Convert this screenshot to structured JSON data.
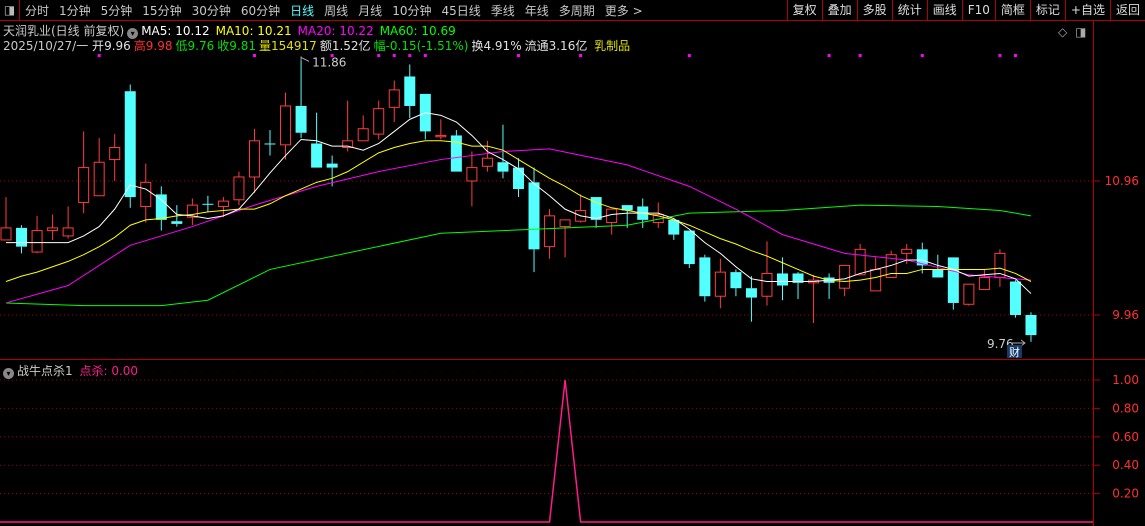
{
  "toolbar": {
    "toggle_icon": "panel-toggle-icon",
    "periods": [
      "分时",
      "1分钟",
      "5分钟",
      "15分钟",
      "30分钟",
      "60分钟",
      "日线",
      "周线",
      "月线",
      "10分钟",
      "45日线",
      "季线",
      "年线",
      "多周期",
      "更多 >"
    ],
    "active_period": "日线",
    "right_buttons": [
      "复权",
      "叠加",
      "多股",
      "统计",
      "画线",
      "F10",
      "简框",
      "标记",
      "+自选",
      "返回"
    ]
  },
  "header": {
    "title": "天润乳业(日线 前复权)",
    "ma": [
      {
        "label": "MA5: 10.12",
        "color": "#ffffff"
      },
      {
        "label": "MA10: 10.21",
        "color": "#ffff00"
      },
      {
        "label": "MA20: 10.22",
        "color": "#ff00ff"
      },
      {
        "label": "MA60: 10.69",
        "color": "#00ff00"
      }
    ],
    "date": "2025/10/27/一",
    "quote": [
      {
        "label": "开",
        "value": "9.96",
        "color": "#e0e0e0"
      },
      {
        "label": "高",
        "value": "9.98",
        "color": "#ff3030"
      },
      {
        "label": "低",
        "value": "9.76",
        "color": "#00e000"
      },
      {
        "label": "收",
        "value": "9.81",
        "color": "#00e000"
      },
      {
        "label": "量",
        "value": "154917",
        "color": "#e0e000"
      },
      {
        "label": "额",
        "value": "1.52亿",
        "color": "#e0e0e0"
      },
      {
        "label": "幅",
        "value": "-0.15(-1.51%)",
        "color": "#00e000"
      },
      {
        "label": "换",
        "value": "4.91%",
        "color": "#e0e0e0"
      },
      {
        "label": "流通",
        "value": "3.16亿",
        "color": "#e0e0e0"
      }
    ],
    "sector": "乳制品",
    "corner_icons": [
      "diamond-icon",
      "panel-toggle-icon"
    ]
  },
  "chart_data": [
    {
      "type": "candlestick",
      "yticks": [
        "10.96",
        "9.96"
      ],
      "colors": {
        "up": "#ff3c3c",
        "down": "#54ffff",
        "ma5": "#ffffff",
        "ma10": "#ffff00",
        "ma20": "#ff00ff",
        "ma60": "#00ff00"
      },
      "candles": [
        [
          10.52,
          10.84,
          10.52,
          10.61
        ],
        [
          10.61,
          10.63,
          10.42,
          10.47
        ],
        [
          10.43,
          10.7,
          10.42,
          10.59
        ],
        [
          10.59,
          10.71,
          10.52,
          10.61
        ],
        [
          10.55,
          10.77,
          10.53,
          10.61
        ],
        [
          10.8,
          11.33,
          10.72,
          11.06
        ],
        [
          10.85,
          11.28,
          10.85,
          11.1
        ],
        [
          11.12,
          11.31,
          10.96,
          11.21
        ],
        [
          11.63,
          11.68,
          10.76,
          10.84
        ],
        [
          10.77,
          11.09,
          10.65,
          10.95
        ],
        [
          10.86,
          10.92,
          10.59,
          10.67
        ],
        [
          10.66,
          10.78,
          10.62,
          10.64
        ],
        [
          10.69,
          10.83,
          10.63,
          10.78
        ],
        [
          10.79,
          10.85,
          10.73,
          10.79
        ],
        [
          10.77,
          10.84,
          10.69,
          10.81
        ],
        [
          10.82,
          11.03,
          10.78,
          10.99
        ],
        [
          10.99,
          11.35,
          10.87,
          11.26
        ],
        [
          11.24,
          11.34,
          11.15,
          11.24
        ],
        [
          11.23,
          11.62,
          11.12,
          11.52
        ],
        [
          11.52,
          11.86,
          11.28,
          11.32
        ],
        [
          11.24,
          11.47,
          11.06,
          11.06
        ],
        [
          11.09,
          11.15,
          10.92,
          11.06
        ],
        [
          11.21,
          11.56,
          11.18,
          11.26
        ],
        [
          11.26,
          11.45,
          11.26,
          11.35
        ],
        [
          11.31,
          11.56,
          11.27,
          11.5
        ],
        [
          11.51,
          11.71,
          11.4,
          11.64
        ],
        [
          11.74,
          11.83,
          11.43,
          11.52
        ],
        [
          11.61,
          11.61,
          11.27,
          11.33
        ],
        [
          11.29,
          11.42,
          11.27,
          11.3
        ],
        [
          11.3,
          11.34,
          11.03,
          11.03
        ],
        [
          10.96,
          11.18,
          10.77,
          11.06
        ],
        [
          11.07,
          11.26,
          11.03,
          11.13
        ],
        [
          11.1,
          11.38,
          10.98,
          11.03
        ],
        [
          11.06,
          11.13,
          10.84,
          10.9
        ],
        [
          10.95,
          11.06,
          10.28,
          10.45
        ],
        [
          10.47,
          10.75,
          10.38,
          10.7
        ],
        [
          10.62,
          10.67,
          10.39,
          10.67
        ],
        [
          10.66,
          10.86,
          10.65,
          10.74
        ],
        [
          10.84,
          10.84,
          10.61,
          10.67
        ],
        [
          10.65,
          10.75,
          10.56,
          10.75
        ],
        [
          10.78,
          10.78,
          10.61,
          10.74
        ],
        [
          10.77,
          10.83,
          10.61,
          10.67
        ],
        [
          10.65,
          10.8,
          10.61,
          10.71
        ],
        [
          10.67,
          10.67,
          10.52,
          10.56
        ],
        [
          10.59,
          10.59,
          10.31,
          10.34
        ],
        [
          10.39,
          10.41,
          10.06,
          10.1
        ],
        [
          10.1,
          10.38,
          10.01,
          10.28
        ],
        [
          10.28,
          10.3,
          10.1,
          10.16
        ],
        [
          10.16,
          10.25,
          9.91,
          10.09
        ],
        [
          10.1,
          10.51,
          10.03,
          10.27
        ],
        [
          10.27,
          10.39,
          10.07,
          10.18
        ],
        [
          10.27,
          10.28,
          10.08,
          10.2
        ],
        [
          10.2,
          10.26,
          9.9,
          10.22
        ],
        [
          10.24,
          10.27,
          10.08,
          10.2
        ],
        [
          10.16,
          10.33,
          10.1,
          10.33
        ],
        [
          10.26,
          10.49,
          10.26,
          10.45
        ],
        [
          10.14,
          10.39,
          10.14,
          10.3
        ],
        [
          10.24,
          10.44,
          10.24,
          10.41
        ],
        [
          10.42,
          10.49,
          10.34,
          10.45
        ],
        [
          10.45,
          10.5,
          10.27,
          10.33
        ],
        [
          10.3,
          10.41,
          10.24,
          10.24
        ],
        [
          10.39,
          10.39,
          10.0,
          10.05
        ],
        [
          10.04,
          10.19,
          10.03,
          10.19
        ],
        [
          10.15,
          10.3,
          10.15,
          10.24
        ],
        [
          10.24,
          10.45,
          10.17,
          10.42
        ],
        [
          10.21,
          10.22,
          9.94,
          9.96
        ],
        [
          9.96,
          9.98,
          9.76,
          9.81
        ]
      ],
      "ma5": [
        10.5,
        10.5,
        10.5,
        10.5,
        10.5,
        10.55,
        10.62,
        10.75,
        10.93,
        10.9,
        10.82,
        10.71,
        10.7,
        10.68,
        10.7,
        10.75,
        10.88,
        11.02,
        11.15,
        11.27,
        11.26,
        11.22,
        11.22,
        11.19,
        11.24,
        11.33,
        11.42,
        11.47,
        11.45,
        11.4,
        11.3,
        11.18,
        11.12,
        11.05,
        10.94,
        10.85,
        10.75,
        10.7,
        10.68,
        10.71,
        10.72,
        10.72,
        10.72,
        10.68,
        10.6,
        10.5,
        10.42,
        10.32,
        10.23,
        10.21,
        10.21,
        10.21,
        10.21,
        10.22,
        10.23,
        10.27,
        10.3,
        10.33,
        10.37,
        10.37,
        10.33,
        10.3,
        10.25,
        10.26,
        10.27,
        10.23,
        10.12
      ],
      "ma10": [
        10.21,
        10.25,
        10.28,
        10.32,
        10.36,
        10.41,
        10.47,
        10.54,
        10.63,
        10.67,
        10.68,
        10.7,
        10.71,
        10.73,
        10.74,
        10.75,
        10.75,
        10.79,
        10.85,
        10.9,
        10.95,
        10.98,
        11.03,
        11.1,
        11.17,
        11.21,
        11.24,
        11.26,
        11.26,
        11.25,
        11.22,
        11.22,
        11.19,
        11.12,
        11.05,
        10.98,
        10.92,
        10.85,
        10.8,
        10.76,
        10.74,
        10.72,
        10.7,
        10.67,
        10.63,
        10.58,
        10.53,
        10.49,
        10.44,
        10.4,
        10.35,
        10.3,
        10.25,
        10.22,
        10.21,
        10.22,
        10.24,
        10.27,
        10.27,
        10.3,
        10.3,
        10.3,
        10.3,
        10.3,
        10.31,
        10.27,
        10.21
      ],
      "ma20_points": [
        [
          1,
          10.05
        ],
        [
          5,
          10.18
        ],
        [
          9,
          10.48
        ],
        [
          13,
          10.62
        ],
        [
          17,
          10.78
        ],
        [
          21,
          10.92
        ],
        [
          25,
          11.03
        ],
        [
          29,
          11.12
        ],
        [
          33,
          11.18
        ],
        [
          36,
          11.2
        ],
        [
          41,
          11.08
        ],
        [
          45,
          10.92
        ],
        [
          48,
          10.75
        ],
        [
          51,
          10.56
        ],
        [
          55,
          10.42
        ],
        [
          59,
          10.37
        ],
        [
          63,
          10.26
        ],
        [
          67,
          10.22
        ]
      ],
      "ma60_points": [
        [
          1,
          10.05
        ],
        [
          6,
          10.03
        ],
        [
          11,
          10.03
        ],
        [
          14,
          10.07
        ],
        [
          18,
          10.3
        ],
        [
          29,
          10.57
        ],
        [
          35,
          10.6
        ],
        [
          41,
          10.63
        ],
        [
          45,
          10.72
        ],
        [
          51,
          10.74
        ],
        [
          56,
          10.78
        ],
        [
          61,
          10.77
        ],
        [
          65,
          10.74
        ],
        [
          67,
          10.7
        ]
      ],
      "marker_candles": [
        7,
        17,
        22,
        25,
        26,
        27,
        28,
        34,
        38,
        45,
        54,
        56,
        60,
        65,
        66
      ],
      "high_label": "11.86",
      "low_label": "9.76",
      "news_badge": "财"
    },
    {
      "type": "line",
      "title": "战牛点杀1",
      "value_label": "点杀: 0.00",
      "yticks": [
        "1.00",
        "0.80",
        "0.60",
        "0.40",
        "0.20"
      ],
      "ylim": [
        0,
        1.05
      ],
      "color": "#ff1a8c",
      "values": [
        0,
        0,
        0,
        0,
        0,
        0,
        0,
        0,
        0,
        0,
        0,
        0,
        0,
        0,
        0,
        0,
        0,
        0,
        0,
        0,
        0,
        0,
        0,
        0,
        0,
        0,
        0,
        0,
        0,
        0,
        0,
        0,
        0,
        0,
        0,
        0,
        1,
        0,
        0,
        0,
        0,
        0,
        0,
        0,
        0,
        0,
        0,
        0,
        0,
        0,
        0,
        0,
        0,
        0,
        0,
        0,
        0,
        0,
        0,
        0,
        0,
        0,
        0,
        0,
        0,
        0,
        0
      ]
    }
  ]
}
